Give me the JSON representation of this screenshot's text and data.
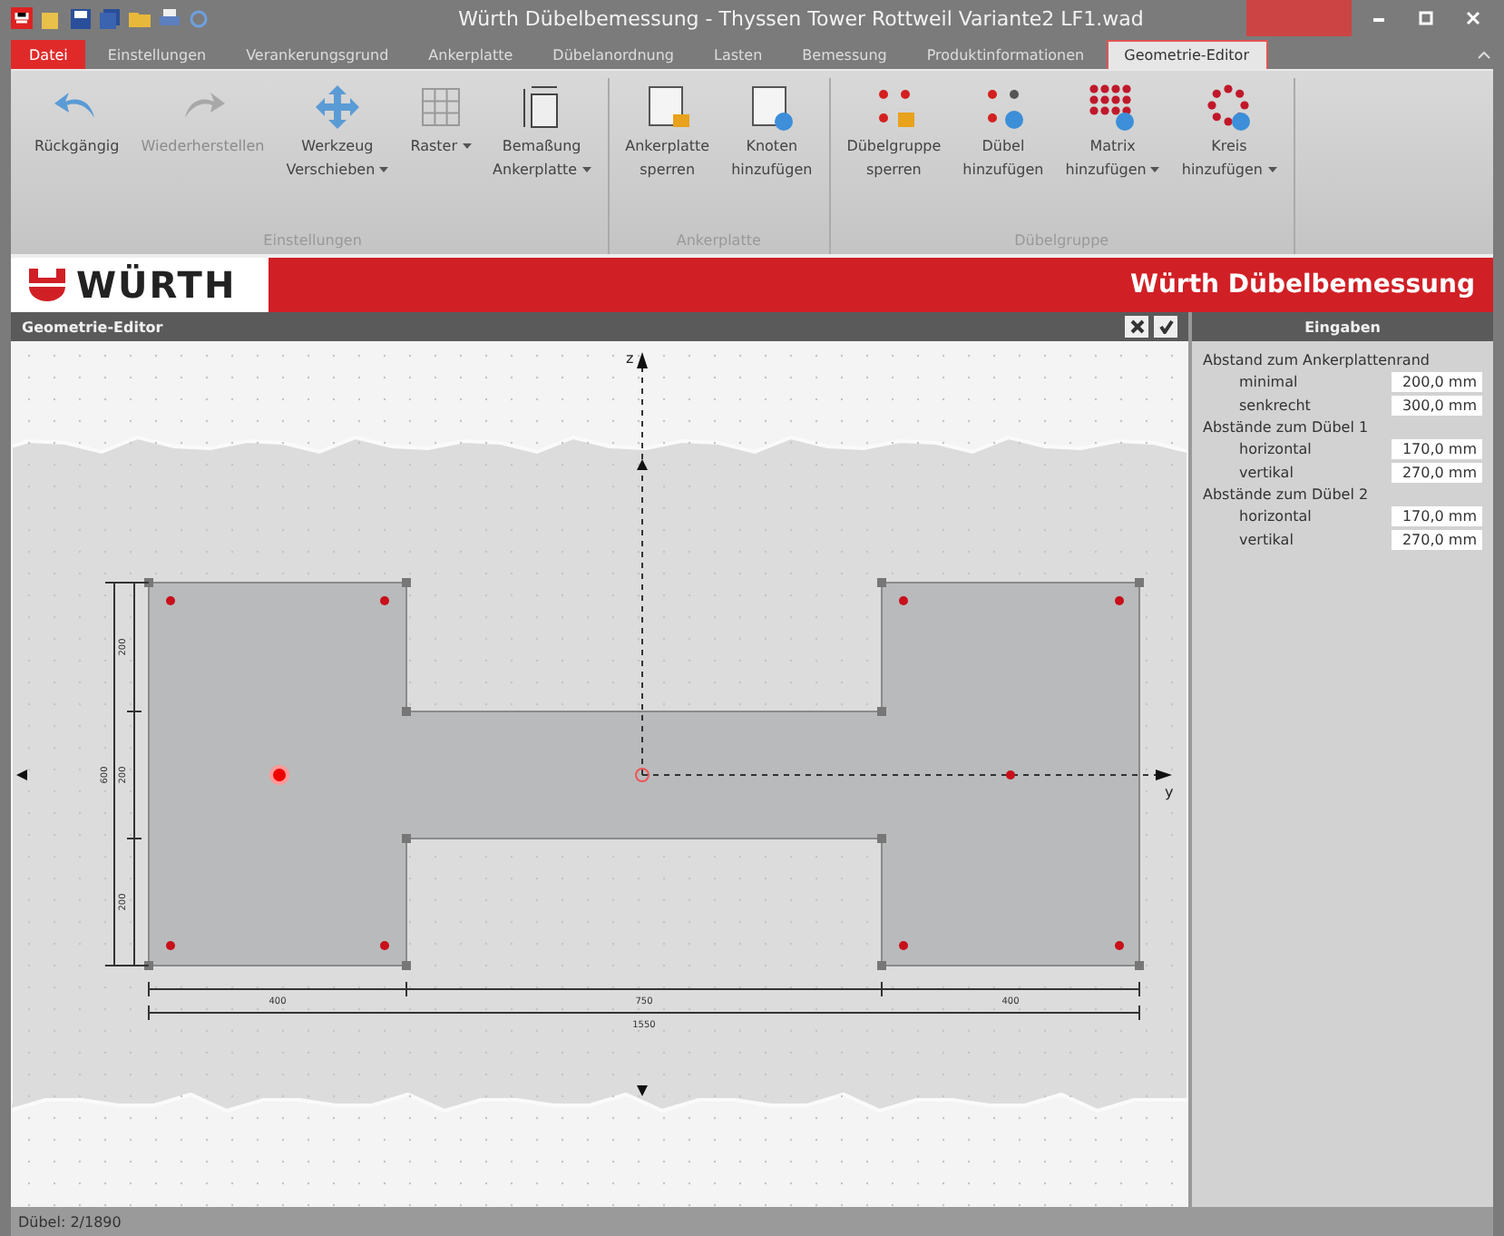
{
  "window": {
    "title": "Würth Dübelbemessung - Thyssen Tower Rottweil Variante2 LF1.wad"
  },
  "tabs": [
    {
      "label": "Datei",
      "kind": "file",
      "selected": false
    },
    {
      "label": "Einstellungen",
      "kind": "tab",
      "selected": false
    },
    {
      "label": "Verankerungsgrund",
      "kind": "tab",
      "selected": false
    },
    {
      "label": "Ankerplatte",
      "kind": "tab",
      "selected": false
    },
    {
      "label": "Dübelanordnung",
      "kind": "tab",
      "selected": false
    },
    {
      "label": "Lasten",
      "kind": "tab",
      "selected": false
    },
    {
      "label": "Bemessung",
      "kind": "tab",
      "selected": false
    },
    {
      "label": "Produktinformationen",
      "kind": "tab",
      "selected": false
    },
    {
      "label": "Geometrie-Editor",
      "kind": "tab",
      "selected": true
    }
  ],
  "ribbon": [
    {
      "label": "Einstellungen",
      "buttons": [
        {
          "lines": [
            "Rückgängig"
          ],
          "disabled": false,
          "dropdown": false
        },
        {
          "lines": [
            "Wiederherstellen"
          ],
          "disabled": true,
          "dropdown": false
        },
        {
          "lines": [
            "Werkzeug",
            "Verschieben"
          ],
          "disabled": false,
          "dropdown": true
        },
        {
          "lines": [
            "Raster"
          ],
          "disabled": false,
          "dropdown": true
        },
        {
          "lines": [
            "Bemaßung",
            "Ankerplatte"
          ],
          "disabled": false,
          "dropdown": true
        }
      ]
    },
    {
      "label": "Ankerplatte",
      "buttons": [
        {
          "lines": [
            "Ankerplatte",
            "sperren"
          ],
          "disabled": false,
          "dropdown": false
        },
        {
          "lines": [
            "Knoten",
            "hinzufügen"
          ],
          "disabled": false,
          "dropdown": false
        }
      ]
    },
    {
      "label": "Dübelgruppe",
      "buttons": [
        {
          "lines": [
            "Dübelgruppe",
            "sperren"
          ],
          "disabled": false,
          "dropdown": false
        },
        {
          "lines": [
            "Dübel",
            "hinzufügen"
          ],
          "disabled": false,
          "dropdown": false
        },
        {
          "lines": [
            "Matrix",
            "hinzufügen"
          ],
          "disabled": false,
          "dropdown": true
        },
        {
          "lines": [
            "Kreis",
            "hinzufügen"
          ],
          "disabled": false,
          "dropdown": true
        }
      ]
    }
  ],
  "banner": {
    "brand": "WÜRTH",
    "title": "Würth Dübelbemessung"
  },
  "editor": {
    "title": "Geometrie-Editor",
    "axes": {
      "z": "z",
      "y": "y"
    },
    "dimensions": {
      "vertical": [
        "200",
        "200",
        "200"
      ],
      "vertical_total": "600",
      "horizontal": [
        "400",
        "750",
        "400"
      ],
      "horizontal_total": "1550"
    },
    "dowels": [
      {
        "selected": false
      },
      {
        "selected": false
      },
      {
        "selected": false
      },
      {
        "selected": false
      },
      {
        "selected": true
      },
      {
        "selected": false
      },
      {
        "selected": false
      },
      {
        "selected": false
      },
      {
        "selected": false
      },
      {
        "selected": false
      }
    ]
  },
  "panel": {
    "title": "Eingaben",
    "sections": [
      {
        "heading": "Abstand zum Ankerplattenrand",
        "rows": [
          {
            "label": "minimal",
            "value": "200,0 mm"
          },
          {
            "label": "senkrecht",
            "value": "300,0 mm"
          }
        ]
      },
      {
        "heading": "Abstände zum Dübel 1",
        "rows": [
          {
            "label": "horizontal",
            "value": "170,0 mm"
          },
          {
            "label": "vertikal",
            "value": "270,0 mm"
          }
        ]
      },
      {
        "heading": "Abstände zum Dübel 2",
        "rows": [
          {
            "label": "horizontal",
            "value": "170,0 mm"
          },
          {
            "label": "vertikal",
            "value": "270,0 mm"
          }
        ]
      }
    ]
  },
  "status_bar": {
    "text": "Dübel: 2/1890"
  }
}
